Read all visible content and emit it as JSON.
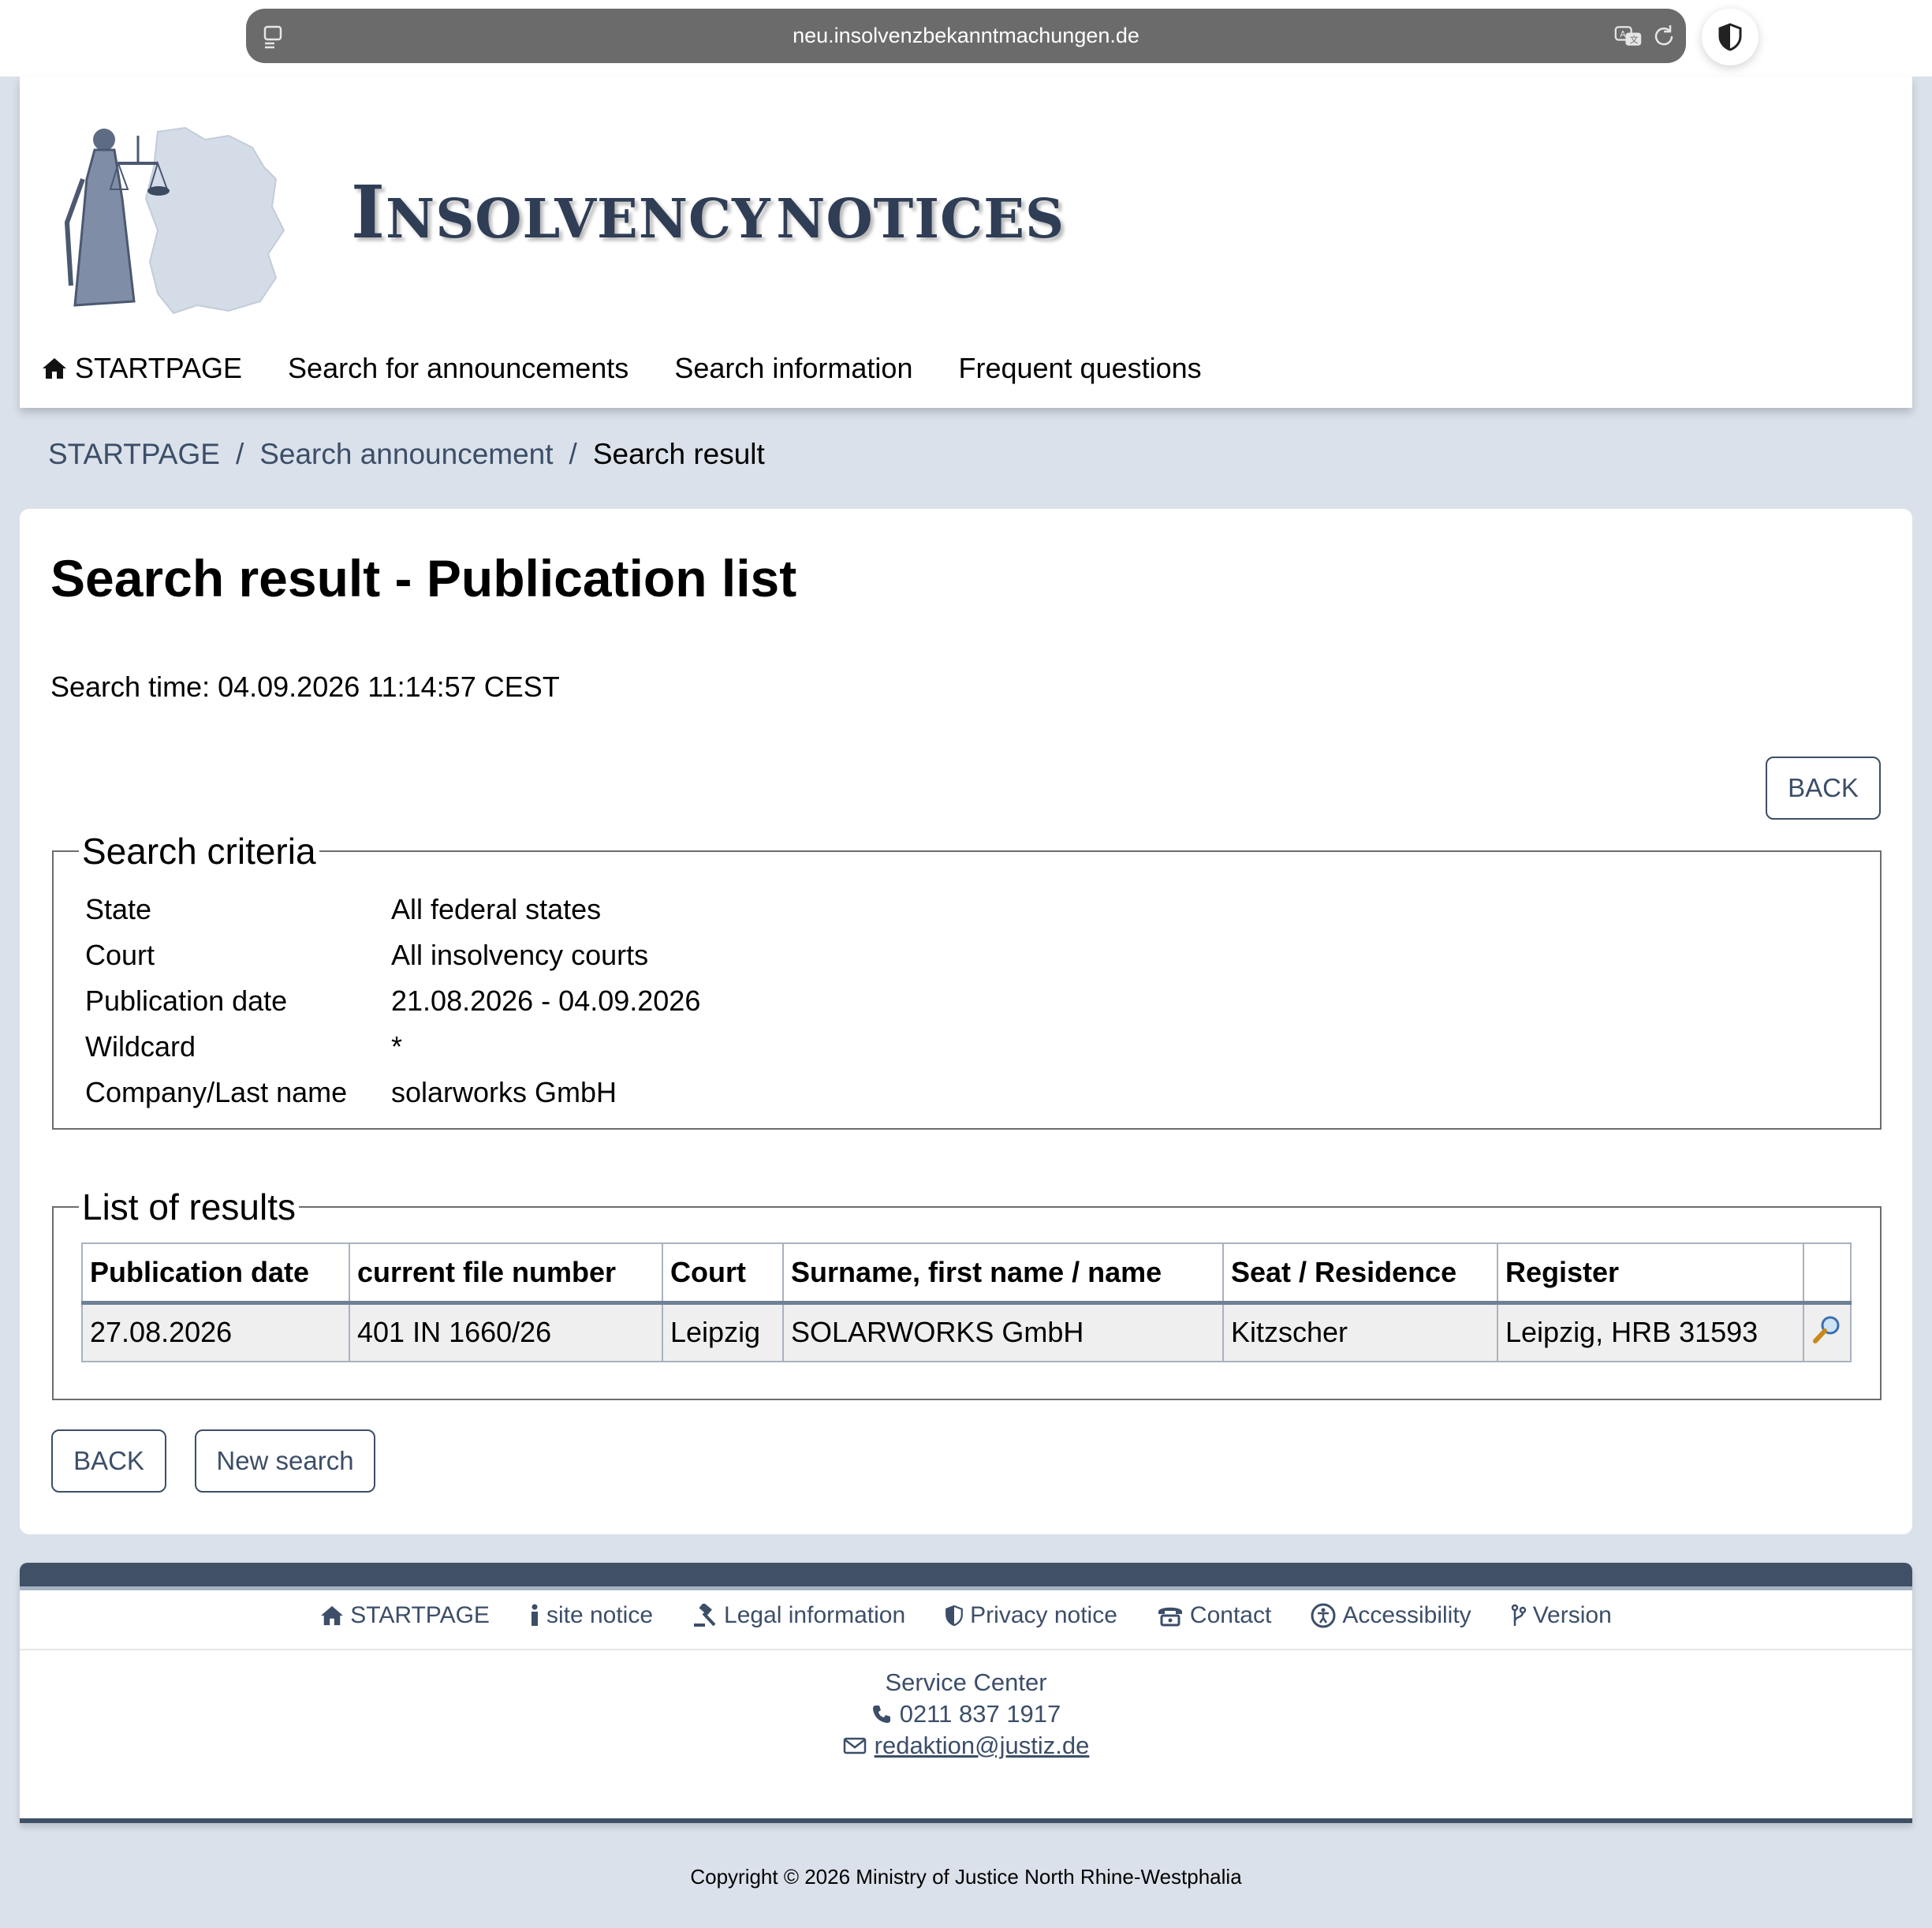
{
  "browser": {
    "url": "neu.insolvenzbekanntmachungen.de"
  },
  "header": {
    "title_initial": "I",
    "title_rest_1": "NSOLVENCY",
    "title_rest_2": "NOTICES"
  },
  "nav": {
    "home": "STARTPAGE",
    "search_announcements": "Search for announcements",
    "search_info": "Search information",
    "faq": "Frequent questions"
  },
  "breadcrumb": {
    "home": "STARTPAGE",
    "search": "Search announcement",
    "current": "Search result",
    "sep": "/"
  },
  "main": {
    "title": "Search result - Publication list",
    "search_time": "Search time: 04.09.2026 11:14:57 CEST",
    "back_label": "BACK",
    "new_search_label": "New search"
  },
  "criteria": {
    "legend": "Search criteria",
    "rows": [
      {
        "label": "State",
        "value": "All federal states"
      },
      {
        "label": "Court",
        "value": "All insolvency courts"
      },
      {
        "label": "Publication date",
        "value": "21.08.2026 - 04.09.2026"
      },
      {
        "label": "Wildcard",
        "value": "*"
      },
      {
        "label": "Company/Last name",
        "value": "solarworks GmbH"
      }
    ]
  },
  "results": {
    "legend": "List of results",
    "columns": [
      "Publication date",
      "current file number",
      "Court",
      "Surname, first name / name",
      "Seat / Residence",
      "Register"
    ],
    "rows": [
      [
        "27.08.2026",
        "401 IN 1660/26",
        "Leipzig",
        "SOLARWORKS GmbH",
        "Kitzscher",
        "Leipzig, HRB 31593"
      ]
    ],
    "row_action_icon": "magnifier-icon"
  },
  "footer": {
    "links": {
      "home": "STARTPAGE",
      "site_notice": "site notice",
      "legal": "Legal information",
      "privacy": "Privacy notice",
      "contact": "Contact",
      "accessibility": "Accessibility",
      "version": "Version"
    },
    "service_center": "Service Center",
    "phone": "0211 837 1917",
    "email": "redaktion@justiz.de",
    "copyright": "Copyright © 2026 Ministry of Justice North Rhine-Westphalia"
  },
  "colors": {
    "accent": "#3c4e68",
    "page_bg": "#dae1ea",
    "footer_bar": "#405166"
  }
}
